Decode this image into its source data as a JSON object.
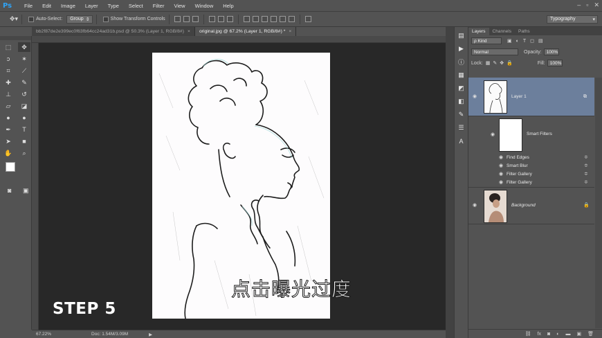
{
  "app": {
    "logo": "Ps"
  },
  "menu": [
    "File",
    "Edit",
    "Image",
    "Layer",
    "Type",
    "Select",
    "Filter",
    "View",
    "Window",
    "Help"
  ],
  "options": {
    "auto_select_label": "Auto-Select:",
    "auto_select_value": "Group",
    "show_transform_label": "Show Transform Controls",
    "workspace": "Typography"
  },
  "tabs": [
    {
      "label": "bb2f87de2e399ec0f63fb64cc24ad31b.psd @ 50.3% (Layer 1, RGB/8#)",
      "close": "×"
    },
    {
      "label": "original.jpg @ 67.2% (Layer 1, RGB/8#) *",
      "close": "×"
    }
  ],
  "status": {
    "zoom": "67.22%",
    "doc": "Doc: 1.54M/3.09M"
  },
  "overlay": {
    "step": "STEP 5",
    "subtitle": "点击曝光过度"
  },
  "layers_panel": {
    "tabs": [
      "Layers",
      "Channels",
      "Paths"
    ],
    "kind": "ρ Kind",
    "blend_mode": "Normal",
    "opacity_label": "Opacity:",
    "opacity_value": "100%",
    "lock_label": "Lock:",
    "fill_label": "Fill:",
    "fill_value": "100%",
    "layer1_name": "Layer 1",
    "smart_filters_label": "Smart Filters",
    "filters": [
      "Find Edges",
      "Smart Blur",
      "Filter Gallery",
      "Filter Gallery"
    ],
    "background_name": "Background"
  },
  "colors": {
    "selected_layer": "#6c7f9c",
    "accent": "#2fa3f6"
  }
}
